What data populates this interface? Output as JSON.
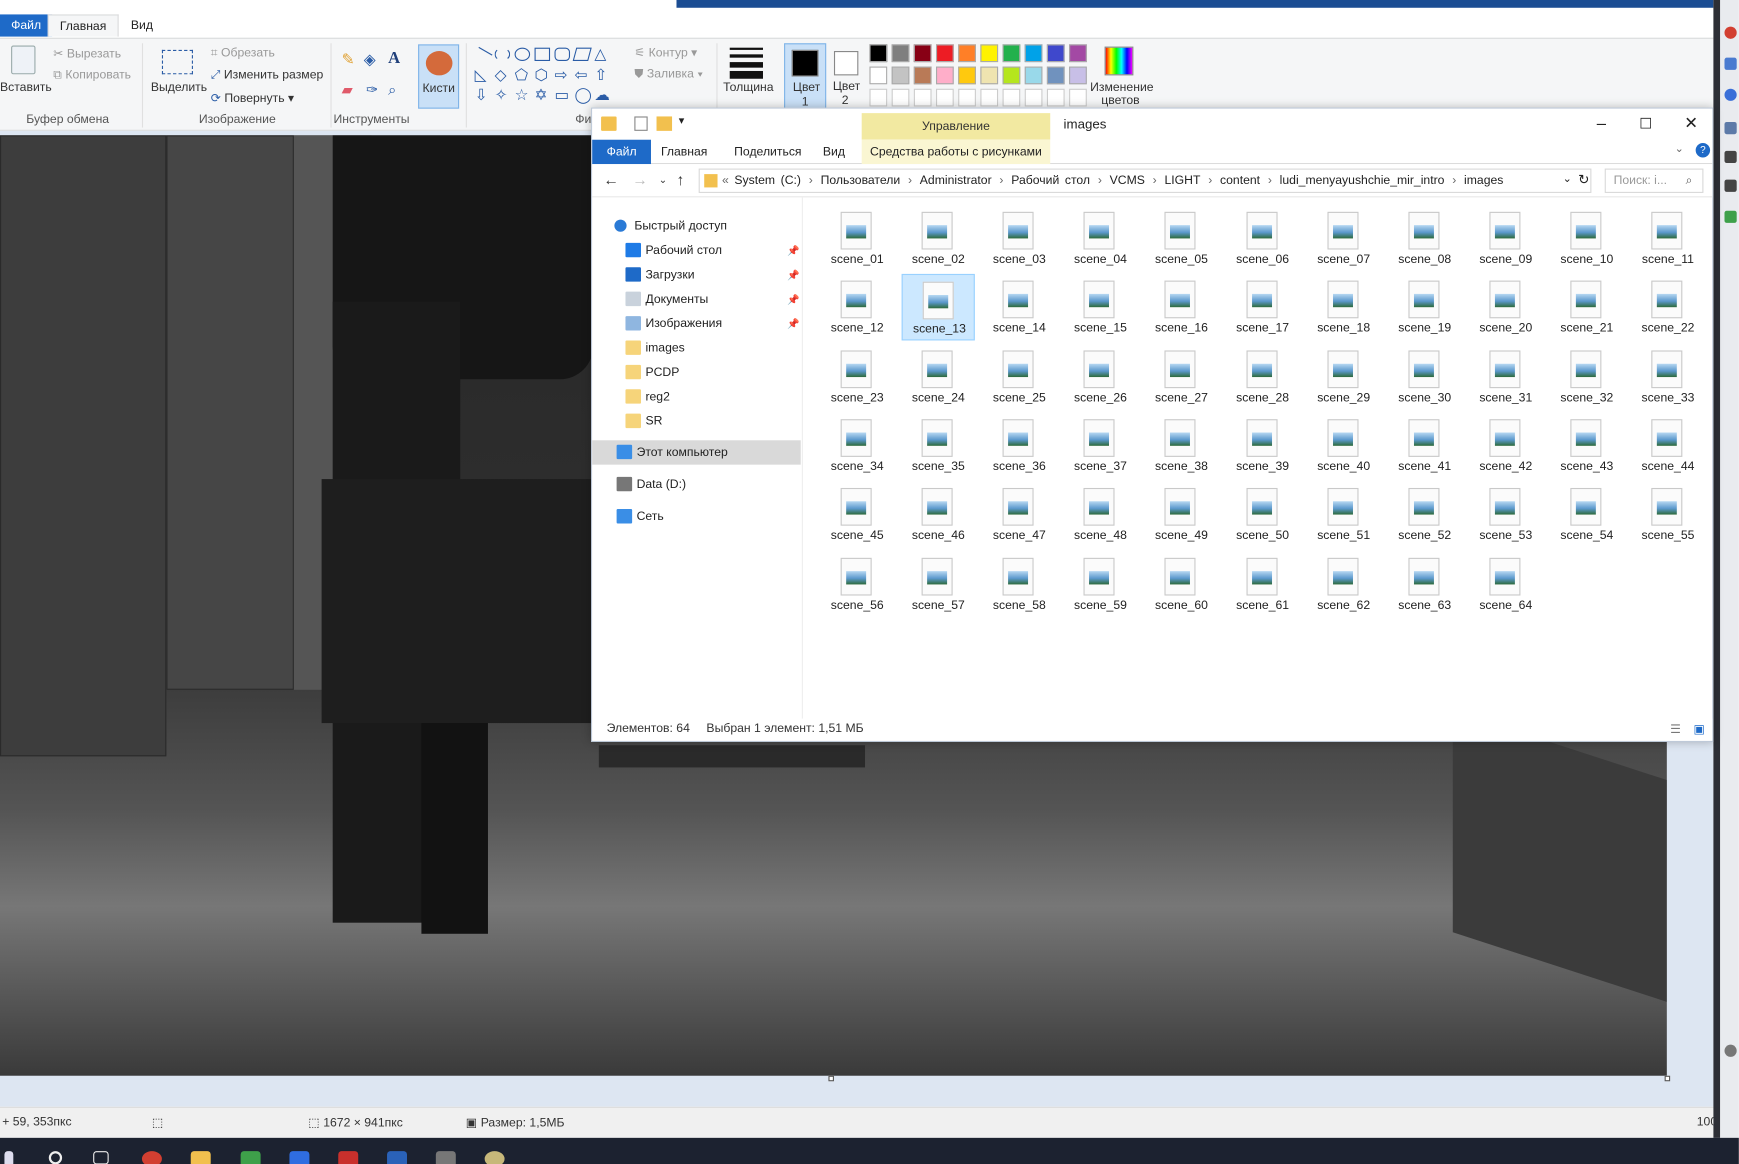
{
  "paint": {
    "tabs": {
      "file": "Файл",
      "home": "Главная",
      "view": "Вид"
    },
    "clipboard": {
      "paste": "Вставить",
      "cut": "Вырезать",
      "copy": "Копировать",
      "group": "Буфер обмена"
    },
    "image": {
      "select": "Выделить",
      "crop": "Обрезать",
      "resize": "Изменить размер",
      "rotate": "Повернуть",
      "group": "Изображение"
    },
    "tools": {
      "group": "Инструменты"
    },
    "brushes": "Кисти",
    "shapes": {
      "outline": "Контур",
      "fill": "Заливка",
      "group": "Фиг"
    },
    "thickness": "Толщина",
    "color1": [
      "Цвет",
      "1"
    ],
    "color2": [
      "Цвет",
      "2"
    ],
    "edit_colors": [
      "Изменение",
      "цветов"
    ],
    "palette": [
      "#000000",
      "#7f7f7f",
      "#880015",
      "#ed1c24",
      "#ff7f27",
      "#fff200",
      "#22b14c",
      "#00a2e8",
      "#3f48cc",
      "#a349a4",
      "#ffffff",
      "#c3c3c3",
      "#b97a57",
      "#ffaec9",
      "#ffc90e",
      "#efe4b0",
      "#b5e61d",
      "#99d9ea",
      "#7092be",
      "#c8bfe7"
    ],
    "status": {
      "cursor": "59, 353пкс",
      "dimensions": "1672 × 941пкс",
      "size": "Размер: 1,5МБ",
      "zoom": "100"
    }
  },
  "explorer": {
    "title": "images",
    "manage_tab": "Управление",
    "tabs": {
      "file": "Файл",
      "home": "Главная",
      "share": "Поделиться",
      "view": "Вид",
      "tools": "Средства работы с рисунками"
    },
    "breadcrumb": [
      "System (C:)",
      "Пользователи",
      "Administrator",
      "Рабочий стол",
      "VCMS",
      "LIGHT",
      "content",
      "ludi_menyayushchie_mir_intro",
      "images"
    ],
    "search_placeholder": "Поиск: i...",
    "nav": {
      "quick_access": "Быстрый доступ",
      "desktop": "Рабочий стол",
      "downloads": "Загрузки",
      "documents": "Документы",
      "pictures": "Изображения",
      "folders": [
        "images",
        "PCDP",
        "reg2",
        "SR"
      ],
      "this_pc": "Этот компьютер",
      "data_drive": "Data (D:)",
      "network": "Сеть"
    },
    "files": [
      "scene_01",
      "scene_02",
      "scene_03",
      "scene_04",
      "scene_05",
      "scene_06",
      "scene_07",
      "scene_08",
      "scene_09",
      "scene_10",
      "scene_11",
      "scene_12",
      "scene_13",
      "scene_14",
      "scene_15",
      "scene_16",
      "scene_17",
      "scene_18",
      "scene_19",
      "scene_20",
      "scene_21",
      "scene_22",
      "scene_23",
      "scene_24",
      "scene_25",
      "scene_26",
      "scene_27",
      "scene_28",
      "scene_29",
      "scene_30",
      "scene_31",
      "scene_32",
      "scene_33",
      "scene_34",
      "scene_35",
      "scene_36",
      "scene_37",
      "scene_38",
      "scene_39",
      "scene_40",
      "scene_41",
      "scene_42",
      "scene_43",
      "scene_44",
      "scene_45",
      "scene_46",
      "scene_47",
      "scene_48",
      "scene_49",
      "scene_50",
      "scene_51",
      "scene_52",
      "scene_53",
      "scene_54",
      "scene_55",
      "scene_56",
      "scene_57",
      "scene_58",
      "scene_59",
      "scene_60",
      "scene_61",
      "scene_62",
      "scene_63",
      "scene_64"
    ],
    "selected_file": "scene_13",
    "status": {
      "count": "Элементов: 64",
      "selection": "Выбран 1 элемент: 1,51 МБ"
    }
  }
}
